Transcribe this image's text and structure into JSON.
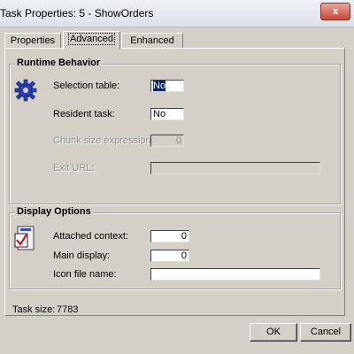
{
  "window": {
    "title": "Task Properties: 5 -   ShowOrders",
    "close_label": "x"
  },
  "tabs": [
    {
      "label": "Properties",
      "active": false
    },
    {
      "label": "Advanced",
      "active": true
    },
    {
      "label": "Enhanced",
      "active": false
    }
  ],
  "runtime": {
    "title": "Runtime Behavior",
    "selection_table": {
      "label": "Selection table:",
      "value": "No"
    },
    "resident_task": {
      "label": "Resident task:",
      "value": "No"
    },
    "chunk_size": {
      "label": "Chunk size expression:",
      "value": "0"
    },
    "exit_url": {
      "label": "Exit URL:",
      "value": ""
    }
  },
  "display": {
    "title": "Display Options",
    "attached_context": {
      "label": "Attached context:",
      "value": "0"
    },
    "main_display": {
      "label": "Main display:",
      "value": "0"
    },
    "icon_file": {
      "label": "Icon file name:",
      "value": ""
    }
  },
  "task_size": {
    "label": "Task size:",
    "value": "7783"
  },
  "buttons": {
    "ok": "OK",
    "cancel": "Cancel"
  },
  "icons": {
    "runtime": "gear-icon",
    "display": "display-options-icon"
  }
}
